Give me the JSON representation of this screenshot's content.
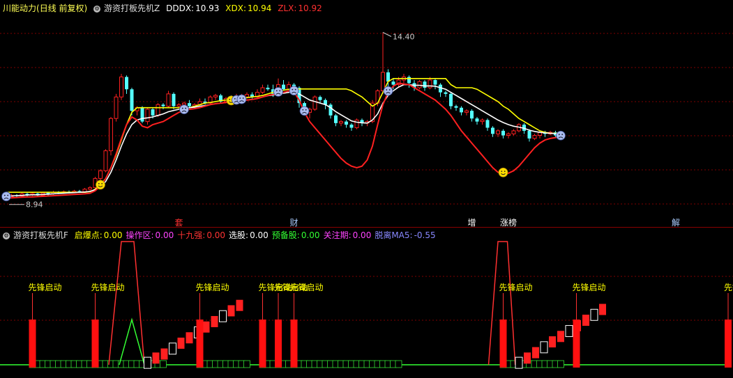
{
  "top_header": {
    "stock": "川能动力",
    "period": "(日线 前复权)",
    "indicator": "游资打板先机Z",
    "dddx_label": "DDDX:",
    "dddx_value": "10.93",
    "xdx_label": "XDX:",
    "xdx_value": "10.94",
    "zlx_label": "ZLX:",
    "zlx_value": "10.92"
  },
  "bottom_header": {
    "indicator": "游资打板先机F",
    "items": [
      {
        "label": "启爆点:",
        "value": "0.00",
        "color": "#ffff00"
      },
      {
        "label": "操作区:",
        "value": "0.00",
        "color": "#ff44ff"
      },
      {
        "label": "十九强:",
        "value": "0.00",
        "color": "#ff3333"
      },
      {
        "label": "选股:",
        "value": "0.00",
        "color": "#ffffff"
      },
      {
        "label": "预备股:",
        "value": "0.00",
        "color": "#33ff33"
      },
      {
        "label": "关注期:",
        "value": "0.00",
        "color": "#ff44ff"
      },
      {
        "label": "脱离MA5:",
        "value": "-0.55",
        "color": "#8888ff"
      }
    ]
  },
  "colors": {
    "up": "#ff2020",
    "down": "#54ffff",
    "dddx_line": "#ffffff",
    "xdx_line": "#ffff00",
    "zlx_line": "#ff2020",
    "grid": "#800000"
  },
  "chart_data": [
    {
      "type": "candlestick",
      "title": "",
      "high_label": "14.40",
      "low_label": "8.94",
      "ylim": [
        8.3,
        15.0
      ],
      "candles": [
        [
          9.12,
          9.05,
          9.18,
          8.94
        ],
        [
          9.05,
          9.1,
          9.15,
          9.0
        ],
        [
          9.1,
          9.08,
          9.14,
          9.02
        ],
        [
          9.08,
          9.15,
          9.2,
          9.04
        ],
        [
          9.15,
          9.12,
          9.18,
          9.06
        ],
        [
          9.12,
          9.16,
          9.2,
          9.08
        ],
        [
          9.16,
          9.1,
          9.19,
          9.05
        ],
        [
          9.1,
          9.18,
          9.22,
          9.08
        ],
        [
          9.18,
          9.15,
          9.22,
          9.1
        ],
        [
          9.15,
          9.2,
          9.25,
          9.12
        ],
        [
          9.2,
          9.18,
          9.24,
          9.14
        ],
        [
          9.18,
          9.22,
          9.26,
          9.15
        ],
        [
          9.22,
          9.2,
          9.26,
          9.16
        ],
        [
          9.2,
          9.24,
          9.28,
          9.18
        ],
        [
          9.24,
          9.22,
          9.28,
          9.18
        ],
        [
          9.22,
          9.3,
          9.34,
          9.2
        ],
        [
          9.3,
          9.35,
          9.4,
          9.26
        ],
        [
          9.35,
          9.65,
          9.7,
          9.32
        ],
        [
          9.65,
          9.9,
          9.95,
          9.6
        ],
        [
          9.9,
          10.55,
          10.6,
          9.85
        ],
        [
          10.55,
          11.6,
          11.65,
          10.4
        ],
        [
          11.6,
          12.3,
          12.4,
          11.5
        ],
        [
          12.3,
          12.95,
          13.05,
          12.2
        ],
        [
          12.95,
          12.55,
          13.0,
          12.4
        ],
        [
          12.55,
          11.85,
          12.6,
          11.7
        ],
        [
          11.85,
          11.95,
          12.0,
          11.7
        ],
        [
          11.95,
          11.5,
          12.0,
          11.45
        ],
        [
          11.5,
          11.9,
          11.95,
          11.4
        ],
        [
          11.9,
          11.7,
          11.95,
          11.6
        ],
        [
          11.7,
          12.05,
          12.1,
          11.65
        ],
        [
          12.05,
          12.0,
          12.1,
          11.9
        ],
        [
          12.0,
          12.4,
          12.5,
          11.95
        ],
        [
          12.4,
          12.0,
          12.45,
          11.9
        ],
        [
          12.0,
          12.05,
          12.1,
          11.95
        ],
        [
          12.05,
          12.1,
          12.15,
          11.95
        ],
        [
          12.1,
          12.0,
          12.2,
          11.95
        ],
        [
          12.0,
          12.05,
          12.1,
          11.9
        ],
        [
          12.05,
          12.15,
          12.25,
          12.0
        ],
        [
          12.15,
          12.1,
          12.25,
          12.05
        ],
        [
          12.1,
          12.3,
          12.35,
          12.05
        ],
        [
          12.3,
          12.35,
          12.4,
          12.2
        ],
        [
          12.35,
          12.15,
          12.4,
          12.1
        ],
        [
          12.15,
          12.25,
          12.3,
          12.1
        ],
        [
          12.25,
          12.2,
          12.35,
          12.15
        ],
        [
          12.2,
          12.3,
          12.4,
          12.15
        ],
        [
          12.3,
          12.3,
          12.4,
          12.2
        ],
        [
          12.3,
          12.38,
          12.45,
          12.25
        ],
        [
          12.38,
          12.3,
          12.45,
          12.25
        ],
        [
          12.3,
          12.45,
          12.55,
          12.25
        ],
        [
          12.45,
          12.6,
          12.7,
          12.4
        ],
        [
          12.6,
          12.55,
          12.7,
          12.5
        ],
        [
          12.55,
          12.4,
          12.7,
          12.3
        ],
        [
          12.4,
          12.7,
          12.9,
          12.35
        ],
        [
          12.7,
          12.55,
          12.85,
          12.5
        ],
        [
          12.55,
          12.7,
          12.8,
          12.5
        ],
        [
          12.7,
          12.6,
          12.75,
          12.45
        ],
        [
          12.6,
          12.1,
          12.65,
          11.95
        ],
        [
          12.1,
          11.8,
          12.15,
          11.7
        ],
        [
          11.8,
          11.9,
          11.95,
          11.6
        ],
        [
          11.9,
          12.3,
          12.35,
          11.85
        ],
        [
          12.3,
          12.2,
          12.35,
          12.1
        ],
        [
          12.2,
          12.05,
          12.25,
          11.9
        ],
        [
          12.05,
          11.7,
          12.1,
          11.6
        ],
        [
          11.7,
          11.45,
          11.75,
          11.35
        ],
        [
          11.45,
          11.5,
          11.55,
          11.35
        ],
        [
          11.5,
          11.4,
          11.55,
          11.3
        ],
        [
          11.4,
          11.3,
          11.45,
          11.2
        ],
        [
          11.3,
          11.55,
          11.6,
          11.25
        ],
        [
          11.55,
          11.45,
          11.6,
          11.35
        ],
        [
          11.45,
          11.5,
          11.55,
          11.35
        ],
        [
          11.5,
          12.1,
          12.2,
          11.45
        ],
        [
          12.1,
          12.5,
          12.55,
          12.0
        ],
        [
          12.5,
          13.1,
          14.4,
          12.4
        ],
        [
          13.1,
          12.8,
          13.2,
          12.6
        ],
        [
          12.8,
          12.7,
          12.9,
          12.55
        ],
        [
          12.7,
          12.85,
          12.95,
          12.6
        ],
        [
          12.85,
          12.95,
          13.05,
          12.75
        ],
        [
          12.95,
          12.75,
          13.0,
          12.6
        ],
        [
          12.75,
          12.6,
          12.85,
          12.5
        ],
        [
          12.6,
          12.8,
          12.85,
          12.55
        ],
        [
          12.8,
          12.6,
          12.85,
          12.5
        ],
        [
          12.6,
          12.85,
          12.95,
          12.55
        ],
        [
          12.85,
          12.7,
          12.9,
          12.55
        ],
        [
          12.7,
          12.45,
          12.75,
          12.3
        ],
        [
          12.45,
          12.4,
          12.5,
          12.3
        ],
        [
          12.4,
          12.0,
          12.45,
          11.9
        ],
        [
          12.0,
          11.95,
          12.05,
          11.85
        ],
        [
          11.95,
          11.8,
          12.0,
          11.7
        ],
        [
          11.8,
          11.85,
          11.9,
          11.7
        ],
        [
          11.85,
          11.6,
          11.9,
          11.5
        ],
        [
          11.6,
          11.5,
          11.65,
          11.4
        ],
        [
          11.5,
          11.55,
          11.6,
          11.4
        ],
        [
          11.55,
          11.3,
          11.6,
          11.2
        ],
        [
          11.3,
          11.1,
          11.35,
          11.0
        ],
        [
          11.1,
          11.2,
          11.25,
          11.0
        ],
        [
          11.2,
          11.05,
          11.25,
          10.95
        ],
        [
          11.05,
          11.1,
          11.15,
          10.95
        ],
        [
          11.1,
          11.2,
          11.25,
          11.05
        ],
        [
          11.2,
          11.4,
          11.45,
          11.15
        ],
        [
          11.4,
          11.2,
          11.45,
          11.1
        ],
        [
          11.2,
          10.95,
          11.25,
          10.85
        ],
        [
          10.95,
          11.05,
          11.1,
          10.9
        ],
        [
          11.05,
          11.15,
          11.2,
          10.95
        ],
        [
          11.15,
          11.1,
          11.2,
          11.0
        ],
        [
          11.1,
          11.15,
          11.2,
          11.05
        ],
        [
          11.15,
          11.05,
          11.2,
          11.0
        ],
        [
          11.05,
          10.95,
          11.1,
          10.9
        ]
      ],
      "dddx": [
        9.08,
        9.08,
        9.09,
        9.1,
        9.11,
        9.12,
        9.12,
        9.13,
        9.14,
        9.15,
        9.16,
        9.17,
        9.18,
        9.19,
        9.2,
        9.21,
        9.23,
        9.28,
        9.38,
        9.55,
        9.85,
        10.25,
        10.7,
        11.1,
        11.4,
        11.55,
        11.6,
        11.62,
        11.65,
        11.7,
        11.75,
        11.82,
        11.86,
        11.9,
        11.92,
        11.95,
        11.97,
        12.0,
        12.02,
        12.05,
        12.08,
        12.1,
        12.12,
        12.14,
        12.16,
        12.18,
        12.2,
        12.22,
        12.25,
        12.3,
        12.34,
        12.36,
        12.4,
        12.42,
        12.45,
        12.46,
        12.4,
        12.3,
        12.2,
        12.15,
        12.1,
        12.05,
        11.95,
        11.82,
        11.72,
        11.62,
        11.52,
        11.48,
        11.46,
        11.45,
        11.55,
        11.75,
        12.1,
        12.35,
        12.5,
        12.62,
        12.7,
        12.7,
        12.68,
        12.68,
        12.66,
        12.66,
        12.65,
        12.6,
        12.55,
        12.45,
        12.35,
        12.25,
        12.15,
        12.05,
        11.95,
        11.85,
        11.75,
        11.65,
        11.55,
        11.47,
        11.4,
        11.35,
        11.32,
        11.28,
        11.22,
        11.18,
        11.15,
        11.13,
        11.12,
        11.11,
        11.1
      ],
      "xdx": [
        9.2,
        9.2,
        9.2,
        9.2,
        9.2,
        9.2,
        9.2,
        9.2,
        9.2,
        9.2,
        9.2,
        9.2,
        9.2,
        9.2,
        9.2,
        9.2,
        9.22,
        9.3,
        9.45,
        9.65,
        10.0,
        10.4,
        10.9,
        11.4,
        11.8,
        11.95,
        11.95,
        11.95,
        11.95,
        11.95,
        11.95,
        11.95,
        11.95,
        11.95,
        11.95,
        11.95,
        12.0,
        12.05,
        12.1,
        12.12,
        12.15,
        12.18,
        12.2,
        12.22,
        12.24,
        12.25,
        12.28,
        12.3,
        12.32,
        12.35,
        12.4,
        12.45,
        12.48,
        12.52,
        12.55,
        12.56,
        12.56,
        12.56,
        12.56,
        12.56,
        12.56,
        12.56,
        12.56,
        12.56,
        12.56,
        12.56,
        12.5,
        12.4,
        12.3,
        12.15,
        12.0,
        12.1,
        12.45,
        12.8,
        12.9,
        12.9,
        12.9,
        12.9,
        12.9,
        12.9,
        12.9,
        12.9,
        12.9,
        12.9,
        12.9,
        12.7,
        12.6,
        12.6,
        12.6,
        12.6,
        12.55,
        12.45,
        12.35,
        12.25,
        12.15,
        12.0,
        11.9,
        11.75,
        11.6,
        11.5,
        11.4,
        11.3,
        11.2,
        11.15,
        11.12,
        11.12,
        11.12
      ],
      "zlx": [
        9.02,
        9.02,
        9.03,
        9.04,
        9.05,
        9.05,
        9.06,
        9.07,
        9.08,
        9.09,
        9.1,
        9.11,
        9.12,
        9.13,
        9.14,
        9.15,
        9.17,
        9.25,
        9.4,
        9.65,
        10.0,
        10.45,
        10.95,
        11.4,
        11.65,
        11.55,
        11.35,
        11.3,
        11.4,
        11.45,
        11.5,
        11.6,
        11.7,
        11.8,
        11.85,
        11.9,
        11.92,
        11.95,
        12.0,
        12.05,
        12.08,
        12.1,
        12.12,
        12.14,
        12.16,
        12.18,
        12.2,
        12.22,
        12.25,
        12.3,
        12.35,
        12.38,
        12.42,
        12.45,
        12.5,
        12.46,
        12.2,
        11.8,
        11.5,
        11.3,
        11.1,
        10.9,
        10.7,
        10.5,
        10.3,
        10.15,
        10.05,
        10.0,
        10.05,
        10.25,
        10.7,
        11.4,
        12.05,
        12.45,
        12.65,
        12.75,
        12.72,
        12.7,
        12.6,
        12.5,
        12.4,
        12.3,
        12.2,
        12.05,
        11.9,
        11.7,
        11.45,
        11.2,
        11.0,
        10.8,
        10.6,
        10.4,
        10.2,
        10.0,
        9.85,
        9.8,
        9.82,
        9.9,
        10.05,
        10.25,
        10.45,
        10.65,
        10.8,
        10.9,
        10.95,
        10.98,
        11.0
      ],
      "markers": [
        {
          "i": 0,
          "type": "sad"
        },
        {
          "i": 18,
          "type": "smile"
        },
        {
          "i": 34,
          "type": "sad"
        },
        {
          "i": 43,
          "type": "smile"
        },
        {
          "i": 44,
          "type": "sad"
        },
        {
          "i": 45,
          "type": "sad"
        },
        {
          "i": 52,
          "type": "sad"
        },
        {
          "i": 55,
          "type": "sad"
        },
        {
          "i": 57,
          "type": "sad"
        },
        {
          "i": 73,
          "type": "sad"
        },
        {
          "i": 95,
          "type": "smile"
        },
        {
          "i": 106,
          "type": "sad"
        },
        {
          "i": 150,
          "type": "smile"
        },
        {
          "i": 152,
          "type": "sad"
        }
      ],
      "event_labels": [
        {
          "i": 33,
          "text": "套",
          "color": "#ff3030"
        },
        {
          "i": 55,
          "text": "财",
          "color": "#aaccff"
        },
        {
          "i": 89,
          "text": "增",
          "color": "#ffffff"
        },
        {
          "i": 96,
          "text": "涨榜",
          "color": "#ffffff"
        },
        {
          "i": 128,
          "text": "解",
          "color": "#aaccff"
        }
      ]
    },
    {
      "type": "bar",
      "title": "",
      "signal_label": "先锋启动",
      "signals": [
        5,
        17,
        37,
        49,
        52,
        55,
        95,
        109,
        138
      ],
      "spikes": [
        {
          "i": 22,
          "type": "red",
          "width": 4
        },
        {
          "i": 24,
          "type": "green",
          "width": 2
        },
        {
          "i": 94,
          "type": "red",
          "width": 3
        }
      ],
      "ladders": [
        {
          "start": 27,
          "values": [
            0.05,
            0.12,
            0.18,
            0.26,
            0.34,
            0.42,
            0.5,
            0.58,
            0.66,
            0.74,
            0.82,
            0.9
          ]
        },
        {
          "start": 98,
          "values": [
            0.05,
            0.12,
            0.2,
            0.28,
            0.36,
            0.44,
            0.52,
            0.6,
            0.68,
            0.76,
            0.84
          ]
        }
      ],
      "operation_zones": [
        [
          5,
          30
        ],
        [
          37,
          46
        ],
        [
          49,
          75
        ],
        [
          95,
          106
        ],
        [
          109,
          115
        ],
        [
          138,
          150
        ]
      ]
    }
  ]
}
